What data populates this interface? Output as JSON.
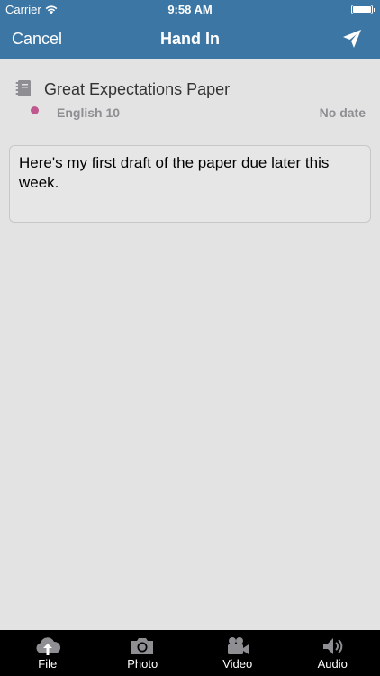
{
  "status_bar": {
    "carrier": "Carrier",
    "time": "9:58 AM",
    "battery_level": 1.0
  },
  "nav": {
    "cancel_label": "Cancel",
    "title": "Hand In",
    "send_icon": "paper-plane-icon"
  },
  "assignment": {
    "icon": "notebook-icon",
    "title": "Great Expectations Paper",
    "course": "English 10",
    "course_color": "#c0578f",
    "due": "No date"
  },
  "comment": {
    "text": "Here's my first draft of the paper due later this week."
  },
  "tabs": [
    {
      "label": "File",
      "icon": "cloud-upload-icon"
    },
    {
      "label": "Photo",
      "icon": "camera-icon"
    },
    {
      "label": "Video",
      "icon": "video-camera-icon"
    },
    {
      "label": "Audio",
      "icon": "speaker-icon"
    }
  ],
  "colors": {
    "header": "#3b76a4",
    "background": "#e3e3e3",
    "tab_bar": "#000000"
  }
}
